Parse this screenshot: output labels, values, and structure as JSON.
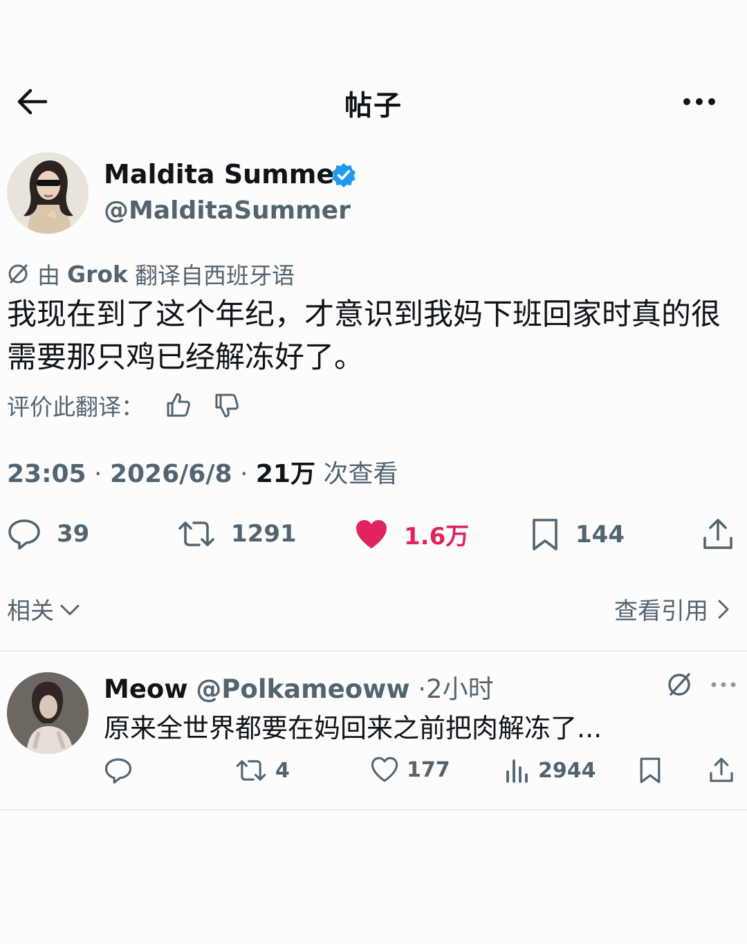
{
  "header": {
    "title": "帖子",
    "back_icon": "arrow-left-icon",
    "more_icon": "more-horizontal-icon"
  },
  "post": {
    "author": {
      "name": "Maldita Summer",
      "handle": "@MalditaSummer",
      "verified": true
    },
    "translation_prefix": "由",
    "translation_source": "Grok",
    "translation_suffix": "翻译自西班牙语",
    "text": "我现在到了这个年纪，才意识到我妈下班回家时真的很需要那只鸡已经解冻好了。",
    "rate_translation_label": "评价此翻译：",
    "time": "23:05",
    "date": "2026/6/8",
    "views_count": "21万",
    "views_label": "次查看",
    "stats": {
      "replies": "39",
      "reposts": "1291",
      "likes": "1.6万",
      "bookmarks": "144"
    },
    "related_label": "相关",
    "view_quotes_label": "查看引用"
  },
  "reply": {
    "name": "Meow",
    "handle": "@Polkameoww",
    "time": "2小时",
    "text": "原来全世界都要在妈回来之前把肉解冻了...",
    "stats": {
      "reposts": "4",
      "likes": "177",
      "views": "2944"
    }
  },
  "colors": {
    "like_active": "#e0245e",
    "verified": "#1d9bf0",
    "secondary_text": "#536471",
    "primary_text": "#0f1419"
  }
}
